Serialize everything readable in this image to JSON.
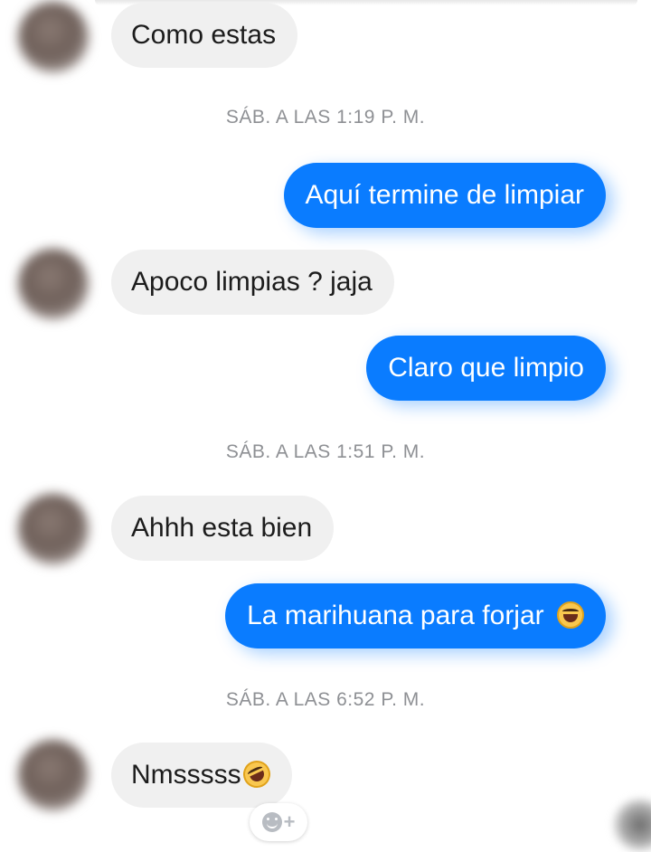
{
  "messages": [
    {
      "type": "incoming",
      "text": "Como estas"
    },
    {
      "type": "timestamp",
      "text": "SÁB. A LAS 1:19 P. M."
    },
    {
      "type": "outgoing",
      "text": "Aquí termine de limpiar"
    },
    {
      "type": "incoming",
      "text": "Apoco limpias ? jaja"
    },
    {
      "type": "outgoing",
      "text": "Claro que limpio"
    },
    {
      "type": "timestamp",
      "text": "SÁB. A LAS 1:51 P. M."
    },
    {
      "type": "incoming",
      "text": "Ahhh esta bien"
    },
    {
      "type": "outgoing",
      "text": "La marihuana para forjar",
      "emoji": "tears-of-joy-emoji"
    },
    {
      "type": "timestamp",
      "text": "SÁB. A LAS 6:52 P. M."
    },
    {
      "type": "incoming",
      "text": "Nmsssss",
      "emoji": "rolling-laughing-emoji"
    }
  ],
  "reaction_button": {
    "icon": "smiley-icon",
    "label": "+"
  },
  "colors": {
    "outgoing_bubble": "#0a7cff",
    "incoming_bubble": "#f0f0f0",
    "timestamp_text": "#8e9094"
  }
}
